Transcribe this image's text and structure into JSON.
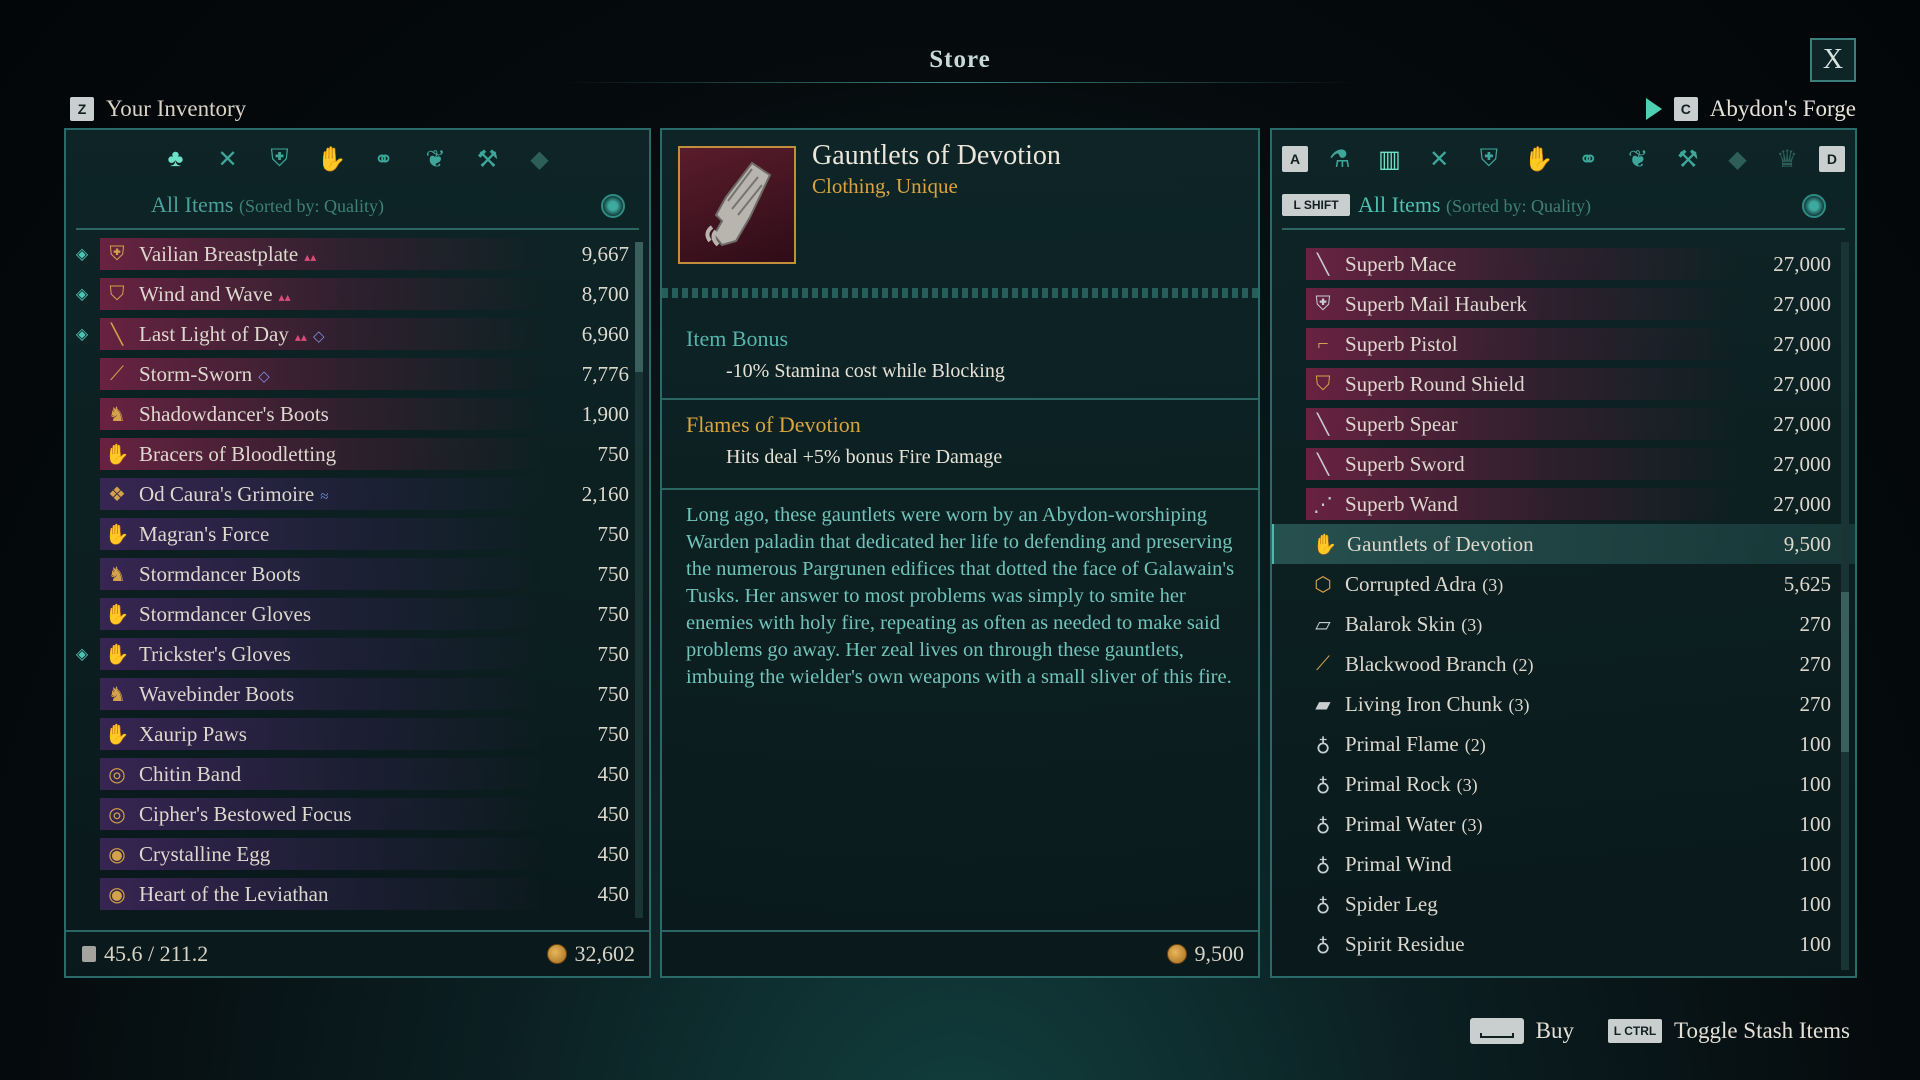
{
  "window": {
    "title": "Store",
    "close_label": "X"
  },
  "left": {
    "key": "Z",
    "title": "Your Inventory",
    "categories": [
      "all-items-icon",
      "weapons-icon",
      "armor-icon",
      "gloves-icon",
      "rings-icon",
      "consumables-icon",
      "anvil-icon",
      "gem-icon"
    ],
    "sort_label": "All Items",
    "sort_sub": "(Sorted by: Quality)",
    "items": [
      {
        "name": "Vailian Breastplate",
        "value": "9,667",
        "pinned": true,
        "stars": "▴▴",
        "tag": "",
        "bar": "pink",
        "icon": "breastplate-icon",
        "glyph": "⛨"
      },
      {
        "name": "Wind and Wave",
        "value": "8,700",
        "pinned": true,
        "stars": "▴▴",
        "tag": "",
        "bar": "pink",
        "icon": "shield-icon",
        "glyph": "⛉"
      },
      {
        "name": "Last Light of Day",
        "value": "6,960",
        "pinned": true,
        "stars": "▴▴",
        "tag": "◇",
        "bar": "pink",
        "icon": "sword-icon",
        "glyph": "╲"
      },
      {
        "name": "Storm-Sworn",
        "value": "7,776",
        "pinned": false,
        "stars": "",
        "tag": "◇",
        "bar": "pink",
        "icon": "bow-icon",
        "glyph": "⟋"
      },
      {
        "name": "Shadowdancer's Boots",
        "value": "1,900",
        "pinned": false,
        "stars": "",
        "tag": "",
        "bar": "pink",
        "icon": "boots-icon",
        "glyph": "♞"
      },
      {
        "name": "Bracers of Bloodletting",
        "value": "750",
        "pinned": false,
        "stars": "",
        "tag": "",
        "bar": "pink",
        "icon": "gauntlet-icon",
        "glyph": "✋"
      },
      {
        "name": "Od Caura's Grimoire",
        "value": "2,160",
        "pinned": false,
        "stars": "",
        "tag": "≈",
        "bar": "purple",
        "icon": "grimoire-icon",
        "glyph": "❖"
      },
      {
        "name": "Magran's Force",
        "value": "750",
        "pinned": false,
        "stars": "",
        "tag": "",
        "bar": "purple",
        "icon": "gauntlet-icon",
        "glyph": "✋"
      },
      {
        "name": "Stormdancer Boots",
        "value": "750",
        "pinned": false,
        "stars": "",
        "tag": "",
        "bar": "purple",
        "icon": "boots-icon",
        "glyph": "♞"
      },
      {
        "name": "Stormdancer Gloves",
        "value": "750",
        "pinned": false,
        "stars": "",
        "tag": "",
        "bar": "purple",
        "icon": "gauntlet-icon",
        "glyph": "✋"
      },
      {
        "name": "Trickster's Gloves",
        "value": "750",
        "pinned": true,
        "stars": "",
        "tag": "",
        "bar": "purple",
        "icon": "gauntlet-icon",
        "glyph": "✋"
      },
      {
        "name": "Wavebinder Boots",
        "value": "750",
        "pinned": false,
        "stars": "",
        "tag": "",
        "bar": "purple",
        "icon": "boots-icon",
        "glyph": "♞"
      },
      {
        "name": "Xaurip Paws",
        "value": "750",
        "pinned": false,
        "stars": "",
        "tag": "",
        "bar": "purple",
        "icon": "gauntlet-icon",
        "glyph": "✋"
      },
      {
        "name": "Chitin Band",
        "value": "450",
        "pinned": false,
        "stars": "",
        "tag": "",
        "bar": "purple",
        "icon": "ring-icon",
        "glyph": "◎"
      },
      {
        "name": "Cipher's Bestowed Focus",
        "value": "450",
        "pinned": false,
        "stars": "",
        "tag": "",
        "bar": "purple",
        "icon": "ring-icon",
        "glyph": "◎"
      },
      {
        "name": "Crystalline Egg",
        "value": "450",
        "pinned": false,
        "stars": "",
        "tag": "",
        "bar": "purple",
        "icon": "amulet-icon",
        "glyph": "◉"
      },
      {
        "name": "Heart of the Leviathan",
        "value": "450",
        "pinned": false,
        "stars": "",
        "tag": "",
        "bar": "purple",
        "icon": "amulet-icon",
        "glyph": "◉"
      }
    ],
    "weight": "45.6 / 211.2",
    "coins": "32,602"
  },
  "detail": {
    "name": "Gauntlets of Devotion",
    "type": "Clothing, Unique",
    "bonus_head": "Item Bonus",
    "bonus_body": "-10% Stamina cost while Blocking",
    "enchant_head": "Flames of Devotion",
    "enchant_body": "Hits deal +5% bonus Fire Damage",
    "lore": "Long ago, these gauntlets were worn by an Abydon-worshiping Warden paladin that dedicated her life to defending and preserving the numerous Pargrunen edifices that dotted the face of Galawain's Tusks. Her answer to most problems was simply to smite her enemies with holy fire, repeating as often as needed to make said problems go away. Her zeal lives on through these gauntlets, imbuing the wielder's own weapons with a small sliver of this fire.",
    "price": "9,500"
  },
  "right": {
    "key": "C",
    "title": "Abydon's Forge",
    "key_prev": "A",
    "key_next": "D",
    "key_shift": "L SHIFT",
    "sort_label": "All Items",
    "sort_sub": "(Sorted by: Quality)",
    "items": [
      {
        "name": "Superb Mace",
        "value": "27,000",
        "bar": "pink",
        "icon": "mace-icon",
        "glyph": "╲",
        "grey": true,
        "sel": false
      },
      {
        "name": "Superb Mail Hauberk",
        "value": "27,000",
        "bar": "pink",
        "icon": "hauberk-icon",
        "glyph": "⛨",
        "grey": true,
        "sel": false
      },
      {
        "name": "Superb Pistol",
        "value": "27,000",
        "bar": "pink",
        "icon": "pistol-icon",
        "glyph": "⌐",
        "grey": false,
        "sel": false
      },
      {
        "name": "Superb Round Shield",
        "value": "27,000",
        "bar": "pink",
        "icon": "shield-icon",
        "glyph": "⛉",
        "grey": false,
        "sel": false
      },
      {
        "name": "Superb Spear",
        "value": "27,000",
        "bar": "pink",
        "icon": "spear-icon",
        "glyph": "╲",
        "grey": true,
        "sel": false
      },
      {
        "name": "Superb Sword",
        "value": "27,000",
        "bar": "pink",
        "icon": "sword-icon",
        "glyph": "╲",
        "grey": true,
        "sel": false
      },
      {
        "name": "Superb Wand",
        "value": "27,000",
        "bar": "pink",
        "icon": "wand-icon",
        "glyph": "⋰",
        "grey": true,
        "sel": false
      },
      {
        "name": "Gauntlets of Devotion",
        "value": "9,500",
        "bar": "none",
        "icon": "gauntlet-icon",
        "glyph": "✋",
        "grey": false,
        "sel": true
      },
      {
        "name": "Corrupted Adra",
        "qty": "(3)",
        "value": "5,625",
        "bar": "none",
        "icon": "adra-icon",
        "glyph": "⬡",
        "grey": false,
        "sel": false
      },
      {
        "name": "Balarok Skin",
        "qty": "(3)",
        "value": "270",
        "bar": "none",
        "icon": "hide-icon",
        "glyph": "▱",
        "grey": true,
        "sel": false
      },
      {
        "name": "Blackwood Branch",
        "qty": "(2)",
        "value": "270",
        "bar": "none",
        "icon": "branch-icon",
        "glyph": "⟋",
        "grey": false,
        "sel": false
      },
      {
        "name": "Living Iron Chunk",
        "qty": "(3)",
        "value": "270",
        "bar": "none",
        "icon": "ingot-icon",
        "glyph": "▰",
        "grey": true,
        "sel": false
      },
      {
        "name": "Primal Flame",
        "qty": "(2)",
        "value": "100",
        "bar": "none",
        "icon": "essence-icon",
        "glyph": "♁",
        "grey": true,
        "sel": false
      },
      {
        "name": "Primal Rock",
        "qty": "(3)",
        "value": "100",
        "bar": "none",
        "icon": "essence-icon",
        "glyph": "♁",
        "grey": true,
        "sel": false
      },
      {
        "name": "Primal Water",
        "qty": "(3)",
        "value": "100",
        "bar": "none",
        "icon": "essence-icon",
        "glyph": "♁",
        "grey": true,
        "sel": false
      },
      {
        "name": "Primal Wind",
        "value": "100",
        "bar": "none",
        "icon": "essence-icon",
        "glyph": "♁",
        "grey": true,
        "sel": false
      },
      {
        "name": "Spider Leg",
        "value": "100",
        "bar": "none",
        "icon": "essence-icon",
        "glyph": "♁",
        "grey": true,
        "sel": false
      },
      {
        "name": "Spirit Residue",
        "value": "100",
        "bar": "none",
        "icon": "essence-icon",
        "glyph": "♁",
        "grey": true,
        "sel": false
      }
    ]
  },
  "actions": {
    "buy_label": "Buy",
    "toggle_key": "L CTRL",
    "toggle_label": "Toggle Stash Items"
  }
}
